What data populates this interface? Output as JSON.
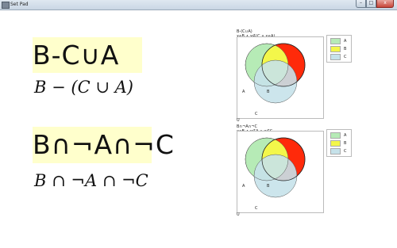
{
  "window": {
    "title": "Set Pad",
    "min_glyph": "–",
    "max_glyph": "□",
    "close_glyph": "x"
  },
  "expressions": [
    {
      "handwritten": "B-C∪A",
      "typeset": "B − (C ∪ A)",
      "venn": {
        "formula_line1": "B-(C∪A)",
        "formula_line2": "x∊B  ∧  x∉(C ∨ x∊A)",
        "universe_label": "U",
        "circle_labels": {
          "A": "A",
          "B": "B",
          "C": "C"
        },
        "highlighted_region": "B only"
      }
    },
    {
      "handwritten": "B∩¬A∩¬C",
      "typeset": "B ∩ ¬A ∩ ¬C",
      "venn": {
        "formula_line1": "B∩¬A∩¬C",
        "formula_line2": "x∊B  ∧  x∉A  ∧  x∉C",
        "universe_label": "U",
        "circle_labels": {
          "A": "A",
          "B": "B",
          "C": "C"
        },
        "highlighted_region": "B only"
      }
    }
  ],
  "legend": [
    {
      "label": "A",
      "color": "#b6ebb6"
    },
    {
      "label": "B",
      "color": "#f3f74a"
    },
    {
      "label": "C",
      "color": "#c6e2ea"
    }
  ],
  "colors": {
    "ink_highlight": "#ffffcc",
    "circle_A": "#b6ebb6",
    "circle_B": "#f3f74a",
    "circle_C": "#c6e2ea",
    "result_region": "#ff2a0a"
  }
}
